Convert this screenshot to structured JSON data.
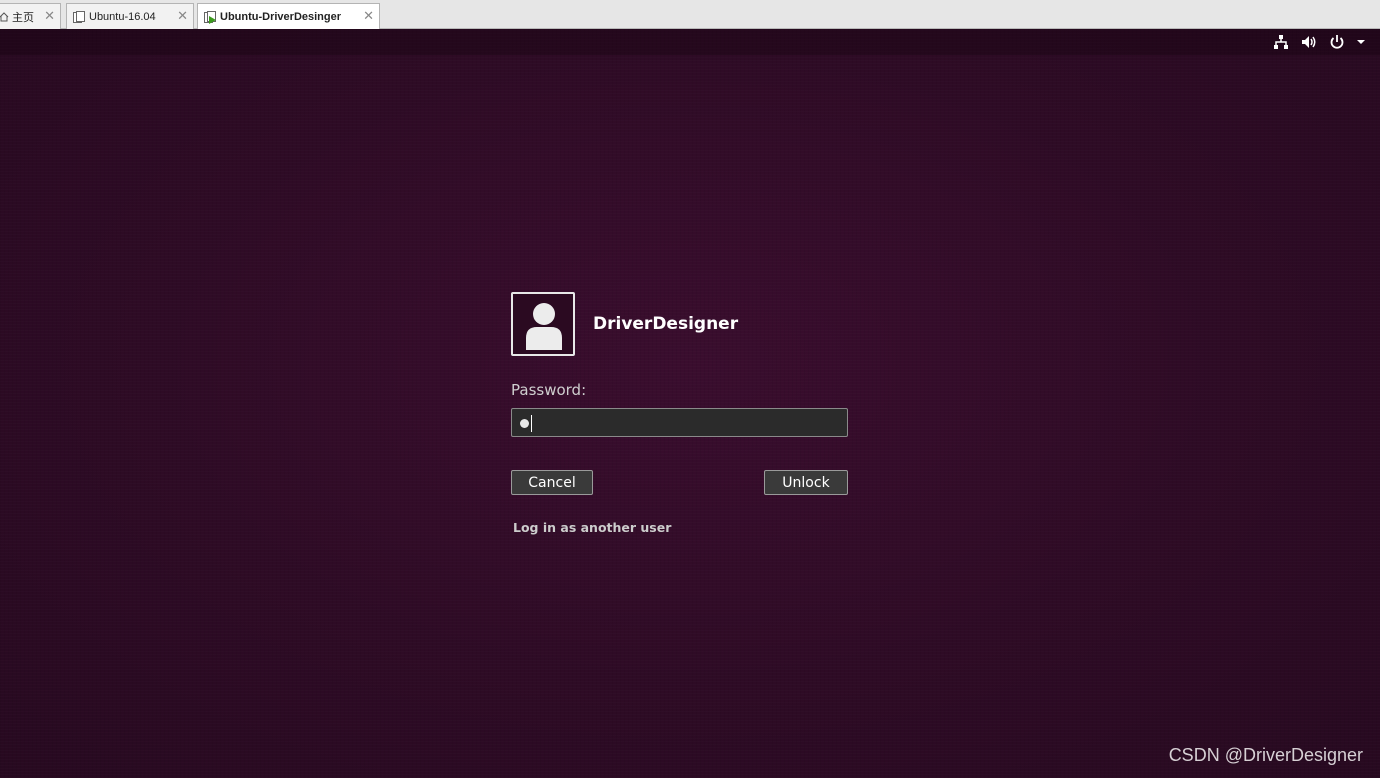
{
  "tabs": [
    {
      "label": "主页",
      "close": "✕"
    },
    {
      "label": "Ubuntu-16.04",
      "close": "✕"
    },
    {
      "label": "Ubuntu-DriverDesinger",
      "close": "✕",
      "active": true
    }
  ],
  "panel": {
    "icons": [
      "network-icon",
      "volume-icon",
      "power-icon",
      "dropdown-arrow-icon"
    ]
  },
  "lock": {
    "username": "DriverDesigner",
    "password_label": "Password:",
    "cancel_label": "Cancel",
    "unlock_label": "Unlock",
    "other_user_label": "Log in as another user"
  },
  "watermark": "CSDN @DriverDesigner",
  "colors": {
    "background": "#2c0a22",
    "field": "#2b2b2b",
    "button": "#3a3a3a"
  }
}
